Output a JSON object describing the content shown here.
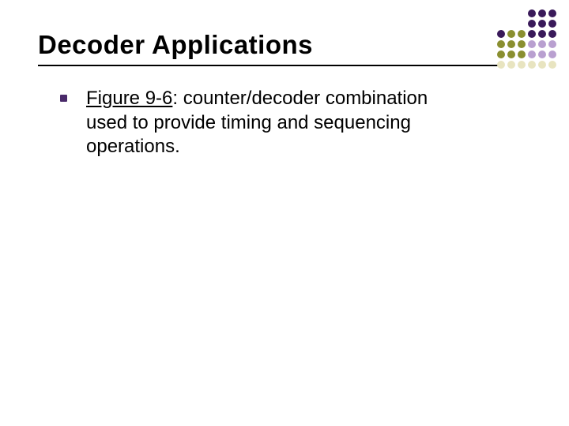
{
  "title": "Decoder Applications",
  "bullet": {
    "figure_ref": "Figure 9-6",
    "rest": ": counter/decoder combination used to provide timing and sequencing operations."
  },
  "deco": {
    "colors": {
      "dark_purple": "#3a1a5a",
      "olive": "#8a8f30",
      "light_purple": "#b9a0d0",
      "cream": "#e8e4c0"
    }
  }
}
